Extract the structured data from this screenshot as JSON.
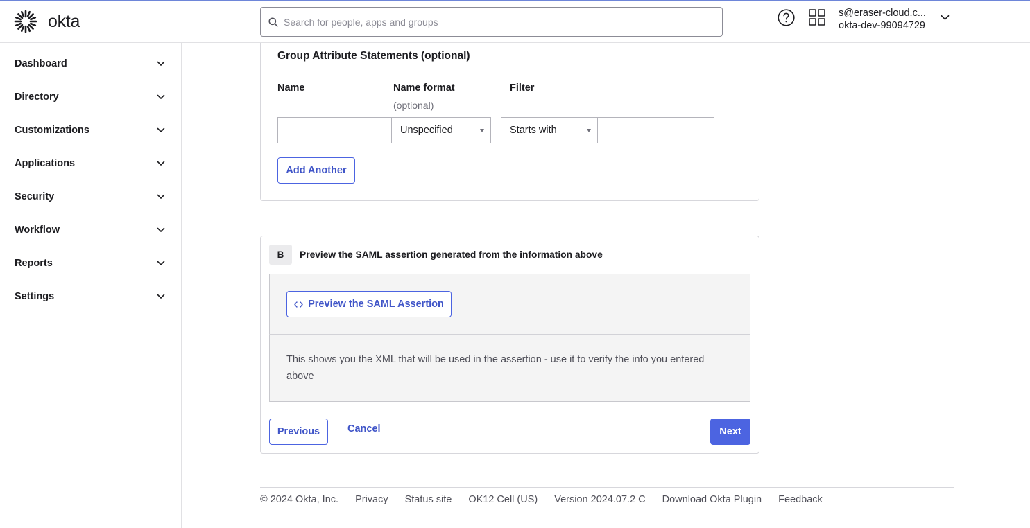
{
  "header": {
    "logo_text": "okta",
    "search_placeholder": "Search for people, apps and groups",
    "user_email": "s@eraser-cloud.c...",
    "user_org": "okta-dev-99094729"
  },
  "sidebar": {
    "items": [
      {
        "label": "Dashboard"
      },
      {
        "label": "Directory"
      },
      {
        "label": "Customizations"
      },
      {
        "label": "Applications"
      },
      {
        "label": "Security"
      },
      {
        "label": "Workflow"
      },
      {
        "label": "Reports"
      },
      {
        "label": "Settings"
      }
    ]
  },
  "group_attributes": {
    "title": "Group Attribute Statements (optional)",
    "name_label": "Name",
    "name_format_label": "Name format",
    "name_format_sub": "(optional)",
    "filter_label": "Filter",
    "name_value": "",
    "name_format_value": "Unspecified",
    "filter_type_value": "Starts with",
    "filter_value": "",
    "add_another_label": "Add Another"
  },
  "preview": {
    "badge": "B",
    "title": "Preview the SAML assertion generated from the information above",
    "button_label": "Preview the SAML Assertion",
    "description": "This shows you the XML that will be used in the assertion - use it to verify the info you entered above"
  },
  "actions": {
    "previous_label": "Previous",
    "cancel_label": "Cancel",
    "next_label": "Next"
  },
  "footer": {
    "items": [
      "© 2024 Okta, Inc.",
      "Privacy",
      "Status site",
      "OK12 Cell (US)",
      "Version 2024.07.2 C",
      "Download Okta Plugin",
      "Feedback"
    ]
  },
  "colors": {
    "accent": "#4c64e1",
    "link": "#4055c8"
  }
}
